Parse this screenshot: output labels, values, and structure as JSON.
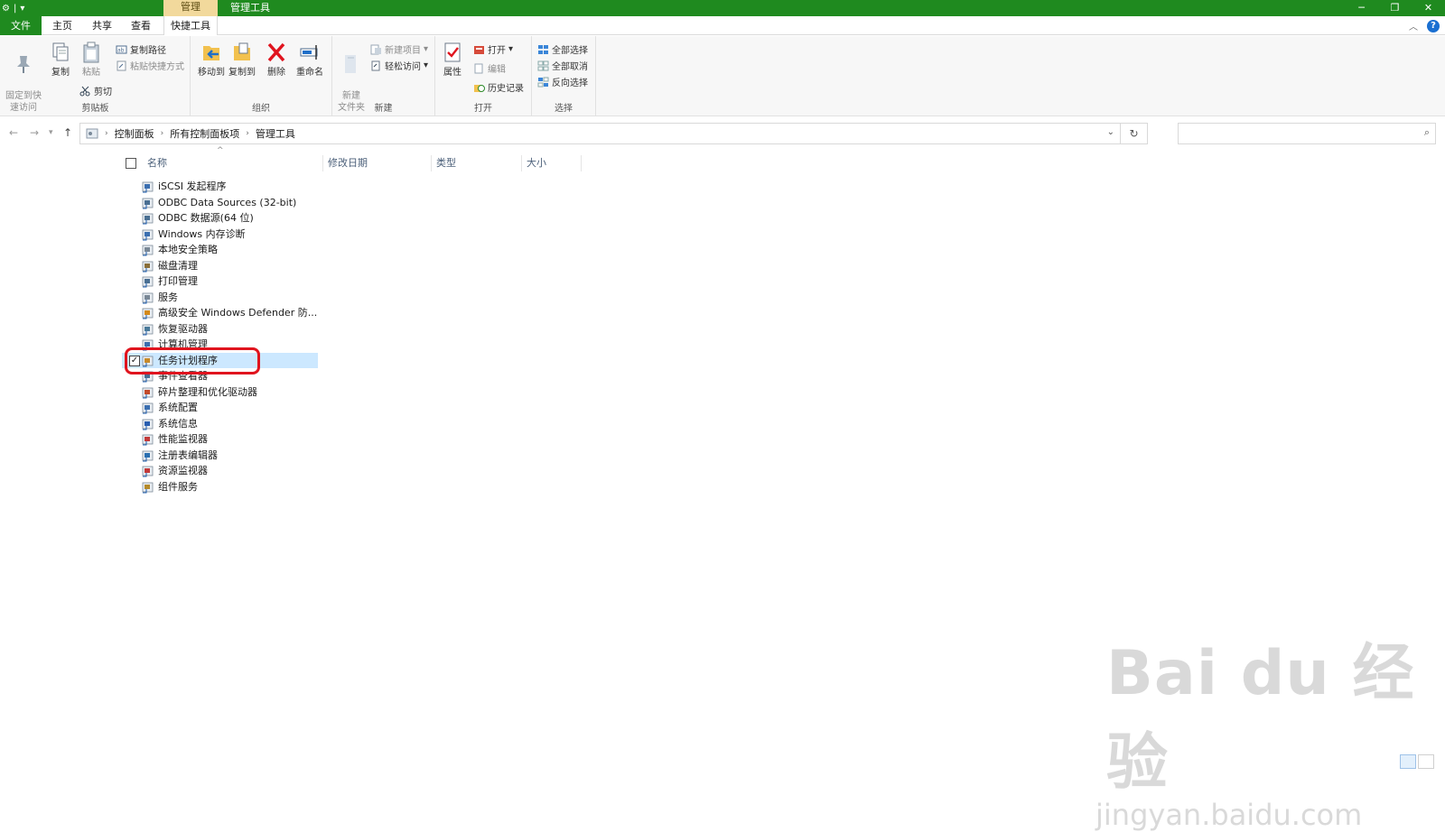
{
  "window": {
    "context_tab": "管理",
    "title": "管理工具",
    "minimize": "─",
    "restore": "❐",
    "close": "✕"
  },
  "tabs": {
    "file": "文件",
    "home": "主页",
    "share": "共享",
    "view": "查看",
    "tools": "快捷工具",
    "help": "?"
  },
  "ribbon": {
    "clipboard": {
      "label": "剪贴板",
      "pin": "固定到快\n速访问",
      "copy": "复制",
      "paste": "粘贴",
      "copy_path": "复制路径",
      "paste_shortcut": "粘贴快捷方式",
      "cut": "剪切"
    },
    "organize": {
      "label": "组织",
      "move_to": "移动到",
      "copy_to": "复制到",
      "delete": "删除",
      "rename": "重命名"
    },
    "new": {
      "label": "新建",
      "new_folder": "新建\n文件夹",
      "new_item": "新建项目",
      "easy_access": "轻松访问"
    },
    "open": {
      "label": "打开",
      "properties": "属性",
      "open": "打开",
      "edit": "编辑",
      "history": "历史记录"
    },
    "select": {
      "label": "选择",
      "select_all": "全部选择",
      "select_none": "全部取消",
      "invert": "反向选择"
    }
  },
  "address": {
    "crumbs": [
      "控制面板",
      "所有控制面板项",
      "管理工具"
    ]
  },
  "columns": {
    "name": "名称",
    "modified": "修改日期",
    "type": "类型",
    "size": "大小"
  },
  "files": [
    {
      "name": "iSCSI 发起程序"
    },
    {
      "name": "ODBC Data Sources (32-bit)"
    },
    {
      "name": "ODBC 数据源(64 位)"
    },
    {
      "name": "Windows 内存诊断"
    },
    {
      "name": "本地安全策略"
    },
    {
      "name": "磁盘清理"
    },
    {
      "name": "打印管理"
    },
    {
      "name": "服务"
    },
    {
      "name": "高级安全 Windows Defender 防..."
    },
    {
      "name": "恢复驱动器"
    },
    {
      "name": "计算机管理"
    },
    {
      "name": "任务计划程序"
    },
    {
      "name": "事件查看器"
    },
    {
      "name": "碎片整理和优化驱动器"
    },
    {
      "name": "系统配置"
    },
    {
      "name": "系统信息"
    },
    {
      "name": "性能监视器"
    },
    {
      "name": "注册表编辑器"
    },
    {
      "name": "资源监视器"
    },
    {
      "name": "组件服务"
    }
  ],
  "selected_index": 11,
  "watermark": {
    "main": "Bai du 经验",
    "sub": "jingyan.baidu.com"
  },
  "colors": {
    "title_green": "#1f8a1f",
    "context_tab": "#f2d99c",
    "selection": "#cce8ff",
    "highlight_ring": "#e0141e"
  }
}
